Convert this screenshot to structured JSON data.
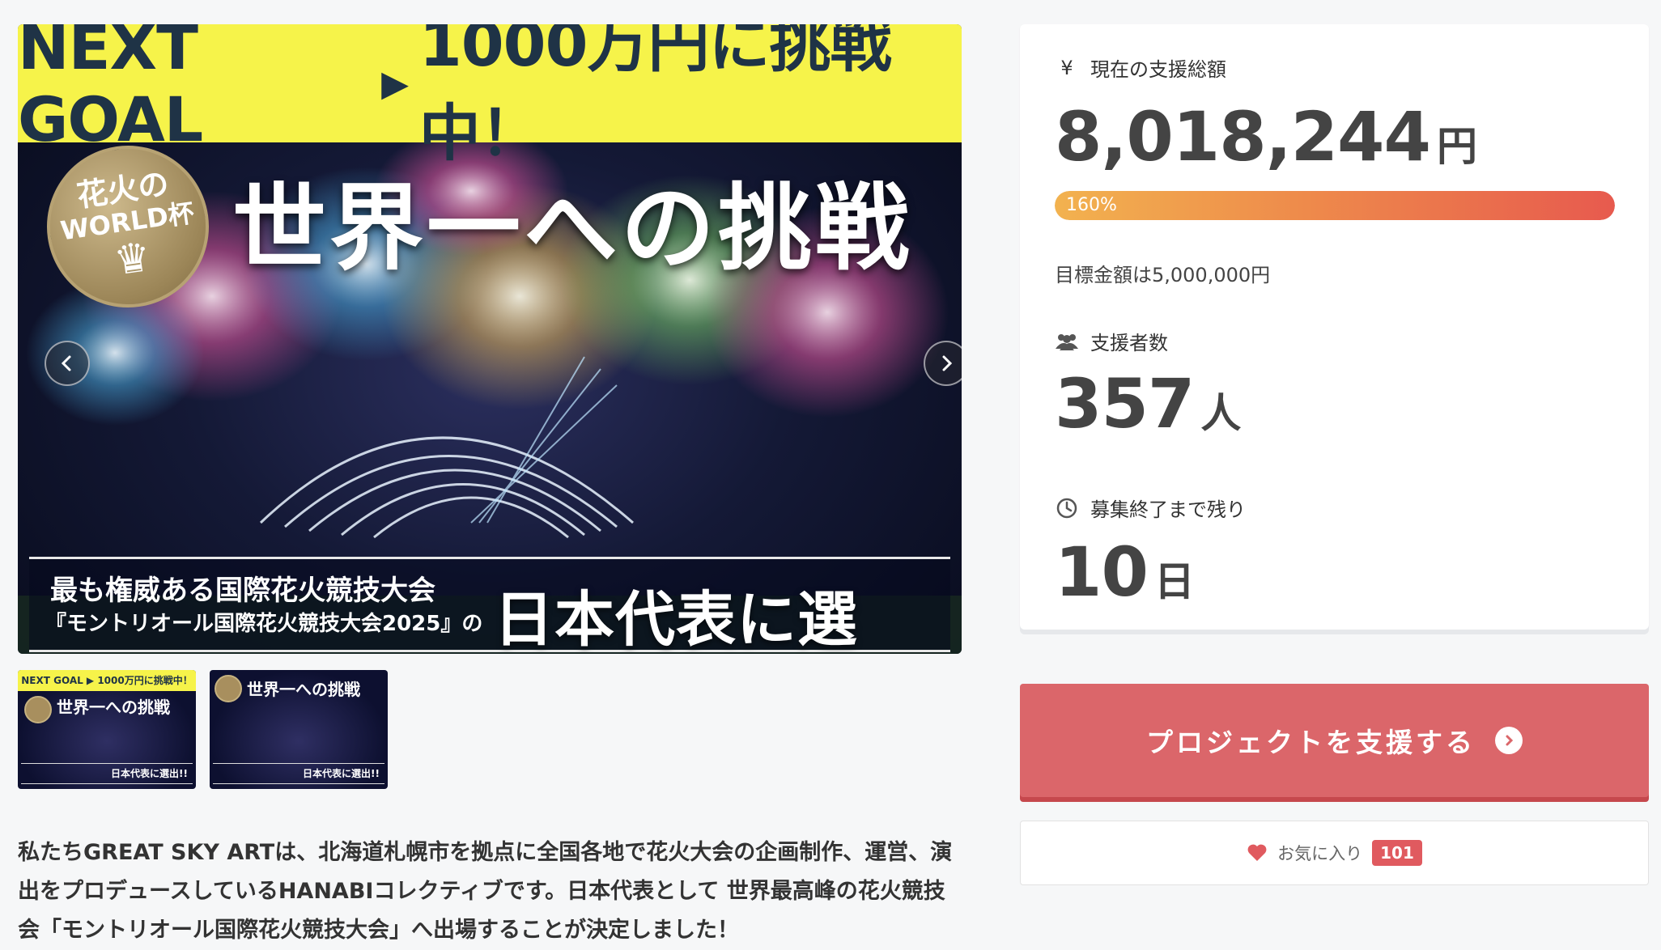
{
  "hero": {
    "goal_banner_left": "NEXT GOAL",
    "goal_banner_arrow": "▶",
    "goal_banner_right": "1000万円に挑戦中！",
    "badge_line1": "花火の",
    "badge_line2": "WORLD杯",
    "badge_crown": "♛",
    "headline": "世界一への挑戦",
    "subtitle_line1": "最も権威ある国際花火競技大会",
    "subtitle_line2": "『モントリオール国際花火競技大会2025』の",
    "selected_text": "日本代表に選出!!",
    "prev_icon": "chevron-left-icon",
    "next_icon": "chevron-right-icon"
  },
  "thumbnails": [
    {
      "goal": "NEXT GOAL ▶ 1000万円に挑戦中！",
      "title": "世界一への挑戦",
      "bottom": "日本代表に選出!!"
    },
    {
      "goal": "",
      "title": "世界一への挑戦",
      "bottom": "日本代表に選出!!"
    }
  ],
  "description": "私たちGREAT SKY ARTは、北海道札幌市を拠点に全国各地で花火大会の企画制作、運営、演出をプロデュースしているHANABIコレクティブです。日本代表として 世界最高峰の花火競技会「モントリオール国際花火競技大会」へ出場することが決定しました！",
  "stats": {
    "total_label": "現在の支援総額",
    "total_icon": "¥",
    "total_value": "8,018,244",
    "total_unit": "円",
    "progress_percent": 160,
    "progress_text": "160%",
    "goal_text": "目標金額は5,000,000円",
    "backers_label": "支援者数",
    "backers_icon": "users-icon",
    "backers_value": "357",
    "backers_unit": "人",
    "remain_label": "募集終了まで残り",
    "remain_icon": "clock-icon",
    "remain_value": "10",
    "remain_unit": "日"
  },
  "actions": {
    "support_label": "プロジェクトを支援する",
    "favorite_label": "お気に入り",
    "favorite_count": "101"
  },
  "colors": {
    "goal_yellow": "#f6f34a",
    "support_red": "#db666a",
    "heart_red": "#e05a5f",
    "progress_start": "#f2b24f",
    "progress_end": "#e75a4e"
  }
}
